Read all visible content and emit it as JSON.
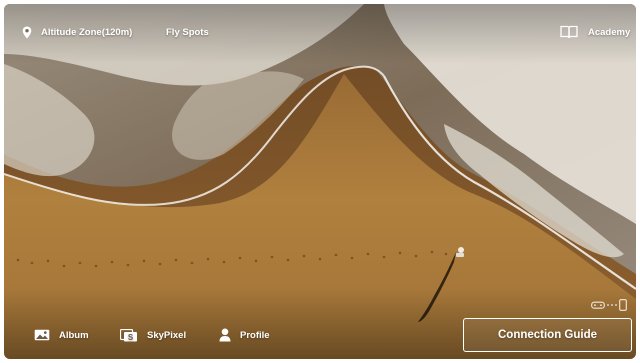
{
  "header": {
    "altitude_zone": "Altitude Zone(120m)",
    "fly_spots": "Fly Spots",
    "academy": "Academy"
  },
  "nav": {
    "album": "Album",
    "skypixel": "SkyPixel",
    "profile": "Profile"
  },
  "connection_guide": "Connection Guide",
  "icons": {
    "altitude": "location-pin-icon",
    "academy": "book-icon",
    "album": "image-icon",
    "skypixel": "skypixel-icon",
    "profile": "person-icon",
    "controller": "controller-icon",
    "phone": "phone-icon"
  },
  "colors": {
    "sand": "#a97a3d",
    "wet_sand": "#7e552a",
    "foam": "#e8e4dc",
    "text": "#ffffff"
  }
}
